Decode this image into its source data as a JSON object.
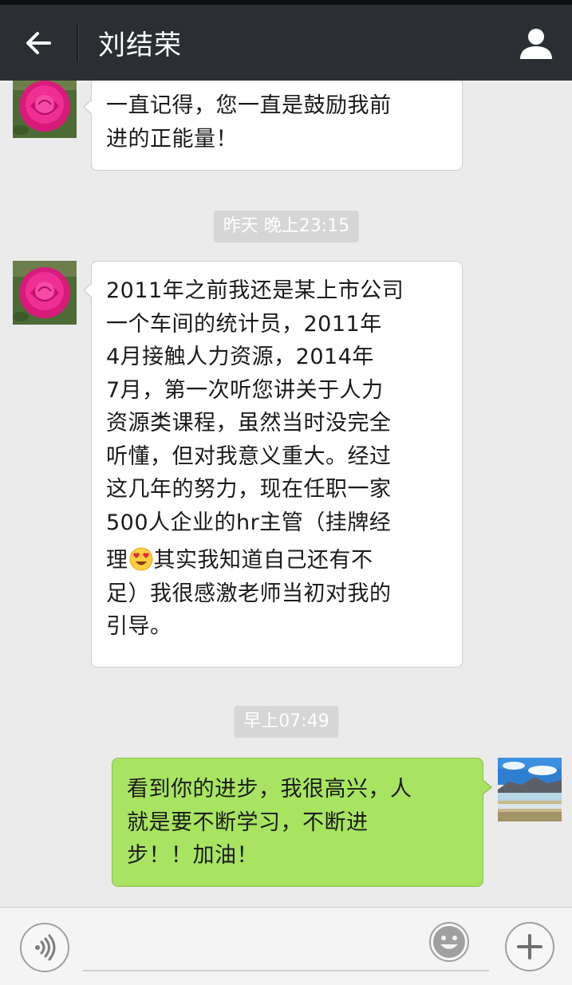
{
  "header": {
    "title": "刘结荣",
    "back_icon": "back-arrow-icon",
    "profile_icon": "person-icon"
  },
  "messages": [
    {
      "direction": "incoming",
      "lines": [
        "一直记得，您一直是鼓励我前",
        "进的正能量！"
      ]
    },
    {
      "type": "timestamp",
      "text": "昨天 晚上23:15"
    },
    {
      "direction": "incoming",
      "lines": [
        "2011年之前我还是某上市公司",
        "一个车间的统计员，2011年",
        "4月接触人力资源，2014年",
        "7月，第一次听您讲关于人力",
        "资源类课程，虽然当时没完全",
        "听懂，但对我意义重大。经过",
        "这几年的努力，现在任职一家",
        "500人企业的hr主管（挂牌经",
        "理",
        "其实我知道自己还有不",
        "足）我很感激老师当初对我的",
        "引导。"
      ],
      "emoji": "heart-eyes-emoji"
    },
    {
      "type": "timestamp",
      "text": "早上07:49"
    },
    {
      "direction": "outgoing",
      "lines": [
        "看到你的进步，我很高兴，人",
        "就是要不断学习，不断进",
        "步！！加油！"
      ]
    }
  ],
  "input_bar": {
    "voice_icon": "voice-icon",
    "emoji_icon": "smiley-icon",
    "plus_icon": "plus-icon",
    "input_value": ""
  },
  "colors": {
    "header_bg": "#2b2f33",
    "chat_bg": "#ebebeb",
    "outgoing_bubble": "#a8e461",
    "incoming_bubble": "#ffffff"
  }
}
